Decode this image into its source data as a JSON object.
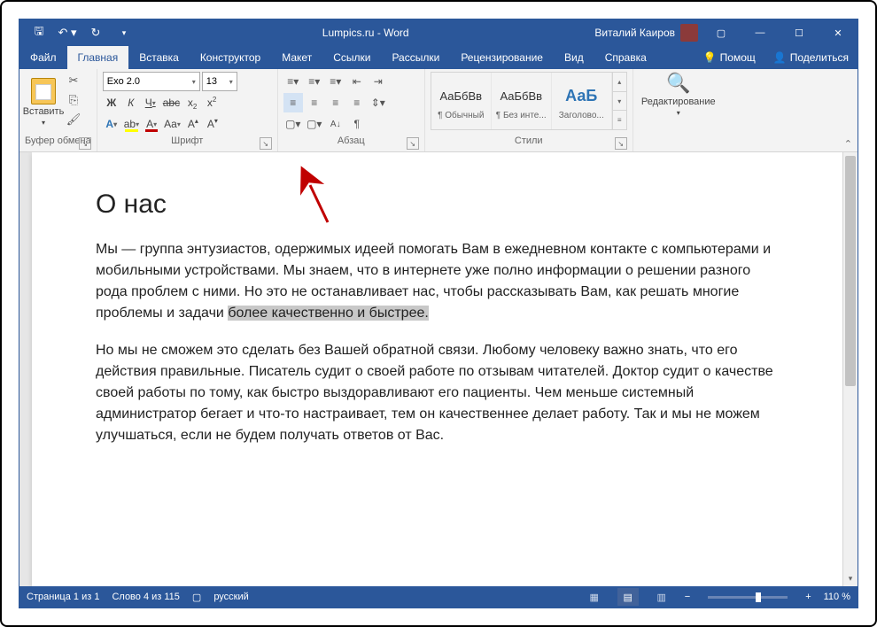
{
  "titlebar": {
    "title": "Lumpics.ru - Word",
    "user": "Виталий Каиров"
  },
  "tabs": {
    "file": "Файл",
    "home": "Главная",
    "insert": "Вставка",
    "design": "Конструктор",
    "layout": "Макет",
    "references": "Ссылки",
    "mailings": "Рассылки",
    "review": "Рецензирование",
    "view": "Вид",
    "help": "Справка",
    "tell": "Помощ",
    "share": "Поделиться"
  },
  "ribbon": {
    "clipboard": {
      "label": "Буфер обмена",
      "paste": "Вставить"
    },
    "font": {
      "label": "Шрифт",
      "name": "Exo 2.0",
      "size": "13"
    },
    "paragraph": {
      "label": "Абзац"
    },
    "styles": {
      "label": "Стили",
      "preview": "АаБбВв",
      "preview_heading": "АаБ",
      "s1": "¶ Обычный",
      "s2": "¶ Без инте...",
      "s3": "Заголово..."
    },
    "editing": {
      "label": "Редактирование"
    }
  },
  "document": {
    "heading": "О нас",
    "p1a": "Мы — группа энтузиастов, одержимых идеей помогать Вам в ежедневном контакте с компьютерами и мобильными устройствами. Мы знаем, что в интернете уже полно информации о решении разного рода проблем с ними. Но это не останавливает нас, чтобы рассказывать Вам, как решать многие проблемы и задачи ",
    "p1_highlight": "более качественно и быстрее.",
    "p2": "Но мы не сможем это сделать без Вашей обратной связи. Любому человеку важно знать, что его действия правильные. Писатель судит о своей работе по отзывам читателей. Доктор судит о качестве своей работы по тому, как быстро выздоравливают его пациенты. Чем меньше системный администратор бегает и что-то настраивает, тем он качественнее делает работу. Так и мы не можем улучшаться, если не будем получать ответов от Вас."
  },
  "statusbar": {
    "page": "Страница 1 из 1",
    "words": "Слово 4 из 115",
    "lang": "русский",
    "zoom": "110 %"
  }
}
